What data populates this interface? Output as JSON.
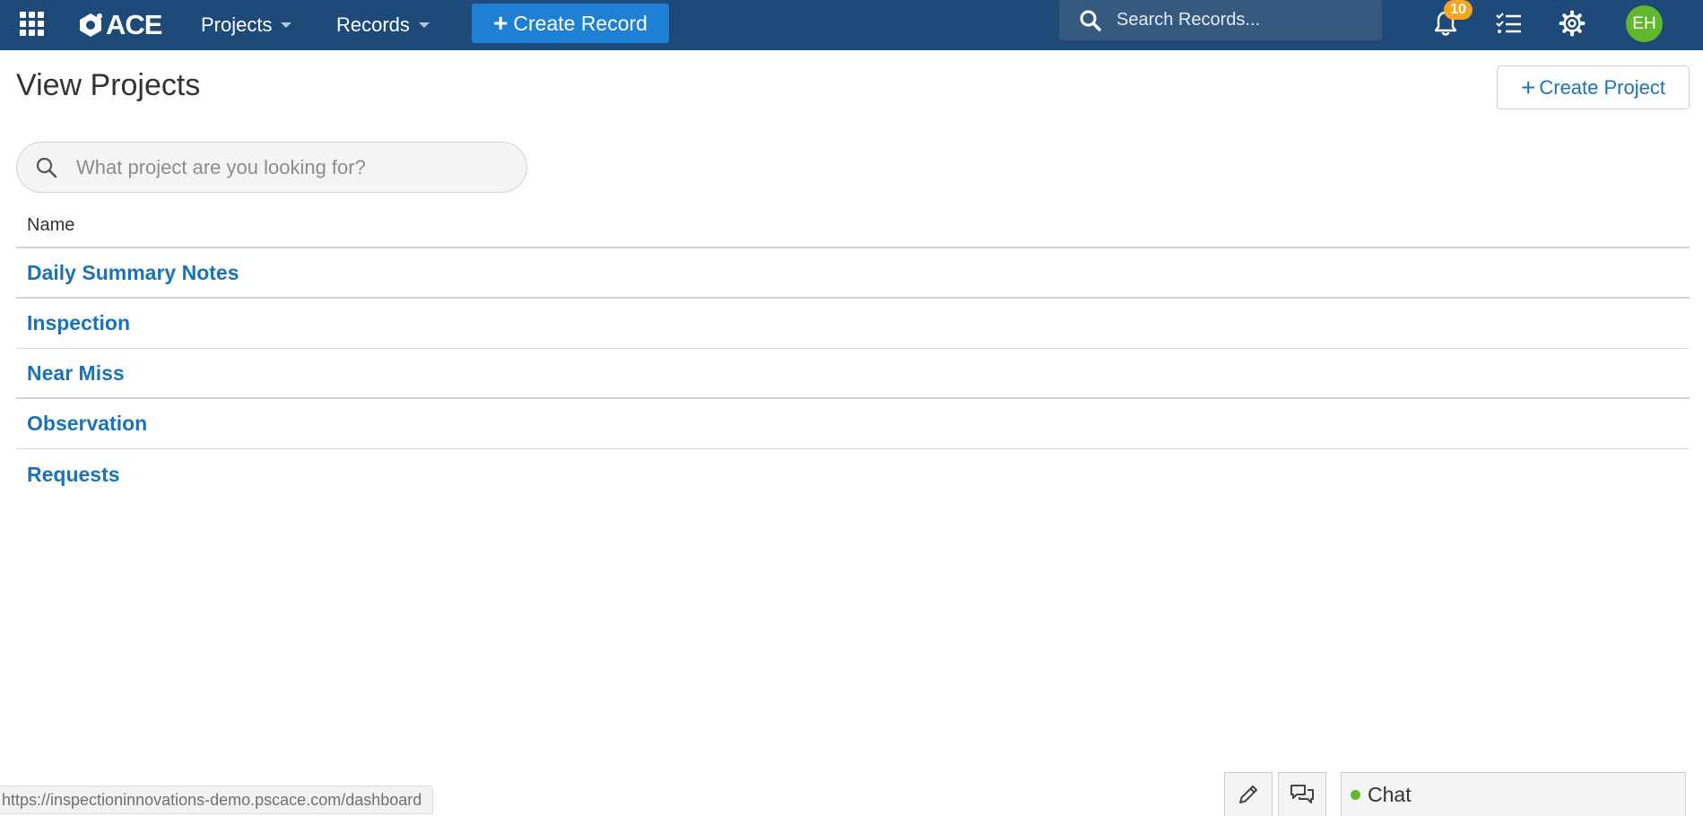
{
  "navbar": {
    "logo_text": "ACE",
    "menus": [
      {
        "label": "Projects"
      },
      {
        "label": "Records"
      }
    ],
    "create_record_label": "Create Record",
    "search_placeholder": "Search Records...",
    "notifications_count": "10",
    "avatar_initials": "EH",
    "colors": {
      "bar": "#1d4a78",
      "primary_button": "#1e80d4",
      "badge": "#f5a623",
      "avatar": "#5fb82d"
    },
    "icons": [
      "apps-grid-icon",
      "search-icon",
      "bell-icon",
      "task-list-icon",
      "gear-icon"
    ]
  },
  "page": {
    "title": "View Projects",
    "create_project_label": "Create Project",
    "search_placeholder": "What project are you looking for?"
  },
  "table": {
    "column_header": "Name",
    "rows": [
      {
        "name": "Daily Summary Notes"
      },
      {
        "name": "Inspection"
      },
      {
        "name": "Near Miss"
      },
      {
        "name": "Observation"
      },
      {
        "name": "Requests"
      }
    ],
    "link_color": "#1a73b9"
  },
  "footer": {
    "status_url": "https://inspectioninnovations-demo.pscace.com/dashboard",
    "chat_label": "Chat",
    "chat_status_color": "#5fb82d",
    "icons": [
      "pencil-icon",
      "comments-icon"
    ]
  }
}
